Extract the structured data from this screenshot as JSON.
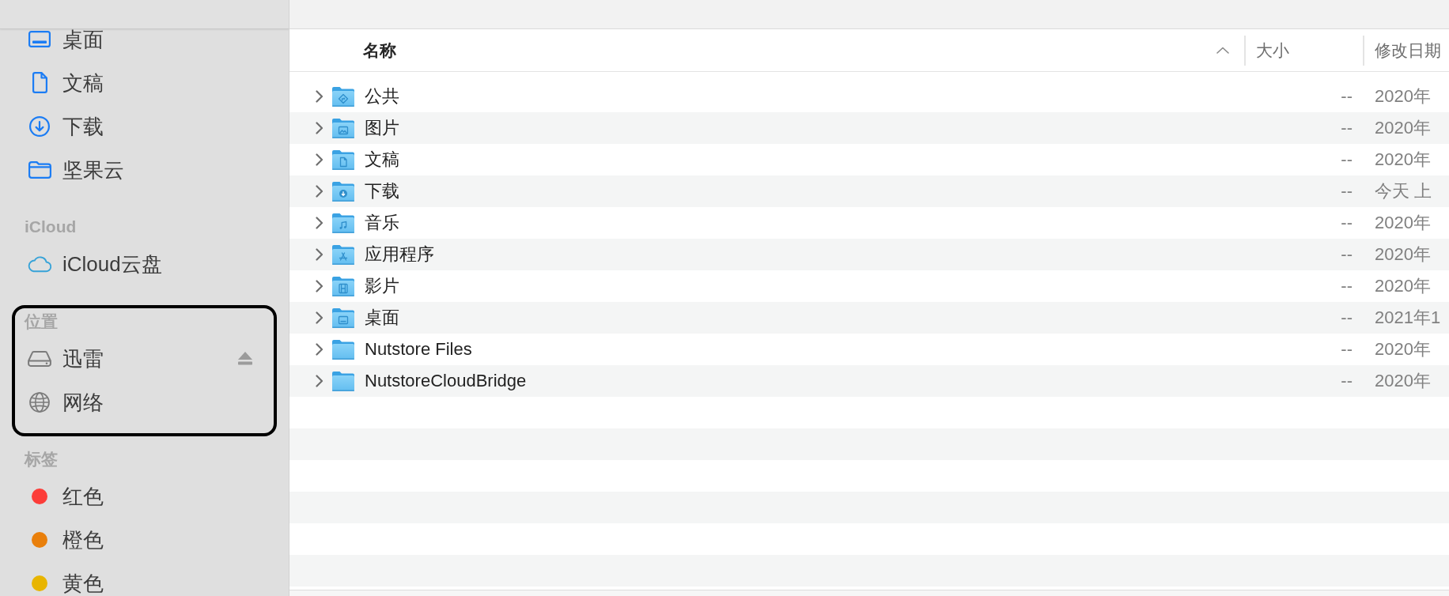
{
  "sidebar": {
    "sections": [
      {
        "highlighted": false,
        "items": [
          {
            "label": "桌面",
            "kind": "desktop",
            "selected": false
          },
          {
            "label": "文稿",
            "kind": "documents",
            "selected": false
          },
          {
            "label": "下载",
            "kind": "downloads",
            "selected": false
          },
          {
            "label": "坚果云",
            "kind": "folder",
            "selected": false
          }
        ]
      },
      {
        "title": "iCloud",
        "highlighted": false,
        "items": [
          {
            "label": "iCloud云盘",
            "kind": "cloud",
            "selected": false
          }
        ]
      },
      {
        "title": "位置",
        "highlighted": true,
        "items": [
          {
            "label": "迅雷",
            "kind": "drive",
            "ejectable": true,
            "selected": false
          },
          {
            "label": "网络",
            "kind": "network",
            "ejectable": false,
            "selected": false
          }
        ]
      },
      {
        "title": "标签",
        "highlighted": false,
        "items": [
          {
            "label": "红色",
            "kind": "tag",
            "color": "#fc3d39",
            "selected": false
          },
          {
            "label": "橙色",
            "kind": "tag",
            "color": "#e97f0b",
            "selected": false
          },
          {
            "label": "黄色",
            "kind": "tag",
            "color": "#e8b500",
            "selected": false
          }
        ]
      }
    ]
  },
  "file_list": {
    "columns": [
      {
        "label": "名称",
        "sorted": true,
        "ascending": true
      },
      {
        "label": "大小",
        "sorted": false
      },
      {
        "label": "修改日期",
        "sorted": false
      }
    ],
    "rows": [
      {
        "name": "公共",
        "kind": "public",
        "size": "--",
        "modified": "2020年",
        "expanded": false,
        "selected": false
      },
      {
        "name": "图片",
        "kind": "pictures",
        "size": "--",
        "modified": "2020年",
        "expanded": false,
        "selected": false
      },
      {
        "name": "文稿",
        "kind": "documents",
        "size": "--",
        "modified": "2020年",
        "expanded": false,
        "selected": false
      },
      {
        "name": "下载",
        "kind": "downloads",
        "size": "--",
        "modified": "今天 上",
        "expanded": false,
        "selected": false
      },
      {
        "name": "音乐",
        "kind": "music",
        "size": "--",
        "modified": "2020年",
        "expanded": false,
        "selected": false
      },
      {
        "name": "应用程序",
        "kind": "applications",
        "size": "--",
        "modified": "2020年",
        "expanded": false,
        "selected": false
      },
      {
        "name": "影片",
        "kind": "movies",
        "size": "--",
        "modified": "2020年",
        "expanded": false,
        "selected": false
      },
      {
        "name": "桌面",
        "kind": "desktop",
        "size": "--",
        "modified": "2021年1",
        "expanded": false,
        "selected": false
      },
      {
        "name": "Nutstore Files",
        "kind": "plain",
        "size": "--",
        "modified": "2020年",
        "expanded": false,
        "selected": false
      },
      {
        "name": "NutstoreCloudBridge",
        "kind": "plain",
        "size": "--",
        "modified": "2020年",
        "expanded": false,
        "selected": false
      }
    ]
  }
}
